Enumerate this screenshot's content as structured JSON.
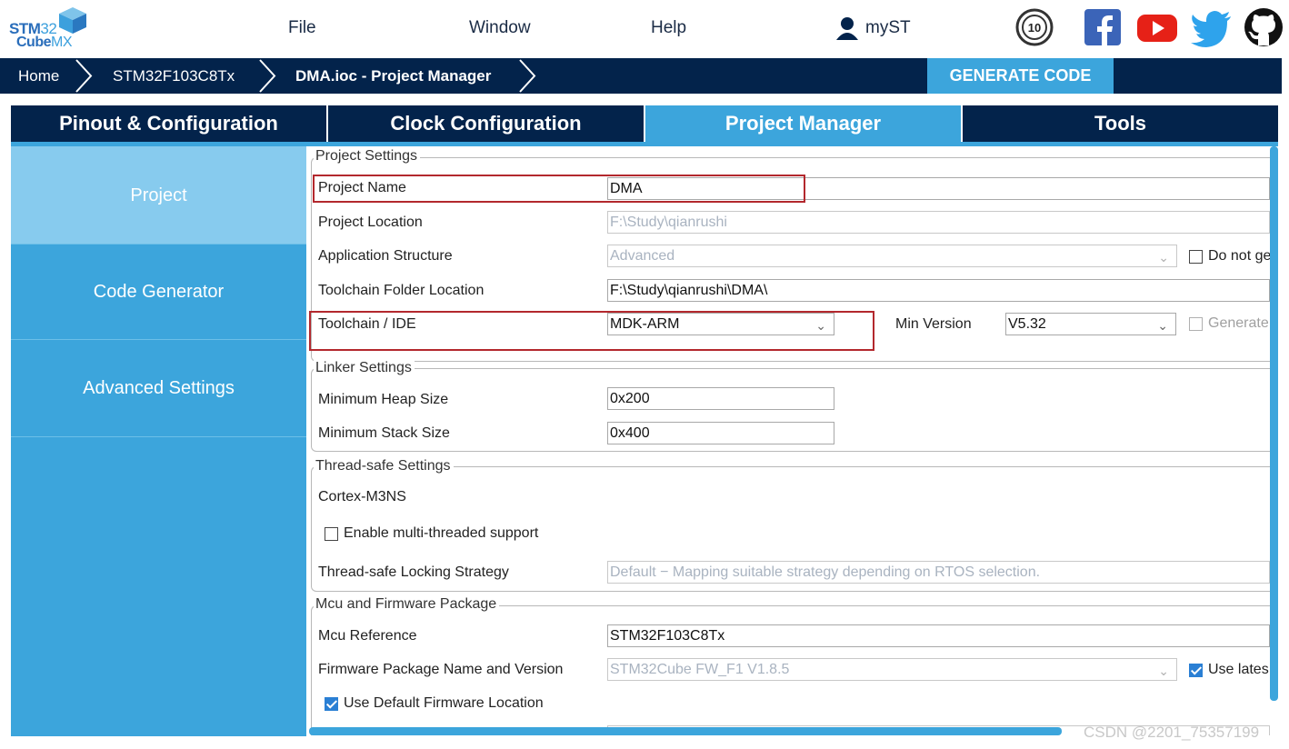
{
  "app": {
    "logo_line1_a": "STM",
    "logo_line1_b": "32",
    "logo_line2_a": "Cube",
    "logo_line2_b": "MX"
  },
  "menu": {
    "file": "File",
    "window": "Window",
    "help": "Help",
    "myst": "myST"
  },
  "breadcrumb": {
    "home": "Home",
    "mcu": "STM32F103C8Tx",
    "project": "DMA.ioc - Project Manager"
  },
  "generate_button": "GENERATE CODE",
  "tabs": [
    "Pinout & Configuration",
    "Clock Configuration",
    "Project Manager",
    "Tools"
  ],
  "active_tab": "Project Manager",
  "leftnav": [
    "Project",
    "Code Generator",
    "Advanced Settings"
  ],
  "project_settings": {
    "legend": "Project Settings",
    "name_label": "Project Name",
    "name_value": "DMA",
    "location_label": "Project Location",
    "location_value": "F:\\Study\\qianrushi",
    "structure_label": "Application Structure",
    "structure_value": "Advanced",
    "do_not_generate": "Do not ge",
    "toolchain_folder_label": "Toolchain Folder Location",
    "toolchain_folder_value": "F:\\Study\\qianrushi\\DMA\\",
    "ide_label": "Toolchain / IDE",
    "ide_value": "MDK-ARM",
    "min_version_label": "Min Version",
    "min_version_value": "V5.32",
    "generate_label": "Generate"
  },
  "linker_settings": {
    "legend": "Linker Settings",
    "heap_label": "Minimum Heap Size",
    "heap_value": "0x200",
    "stack_label": "Minimum Stack Size",
    "stack_value": "0x400"
  },
  "thread_settings": {
    "legend": "Thread-safe Settings",
    "core": "Cortex-M3NS",
    "multithread_label": "Enable multi-threaded support",
    "strategy_label": "Thread-safe Locking Strategy",
    "strategy_value": "Default  −  Mapping suitable strategy depending on RTOS selection."
  },
  "mcu_firmware": {
    "legend": "Mcu and Firmware Package",
    "mcu_label": "Mcu Reference",
    "mcu_value": "STM32F103C8Tx",
    "fw_label": "Firmware Package Name and Version",
    "fw_value": "STM32Cube FW_F1 V1.8.5",
    "use_latest": "Use lates",
    "default_location": "Use Default Firmware Location"
  },
  "watermark": "CSDN @2201_75357199",
  "colors": {
    "navy": "#03234b",
    "accent": "#3ca5dc",
    "highlight": "#b3282d"
  }
}
